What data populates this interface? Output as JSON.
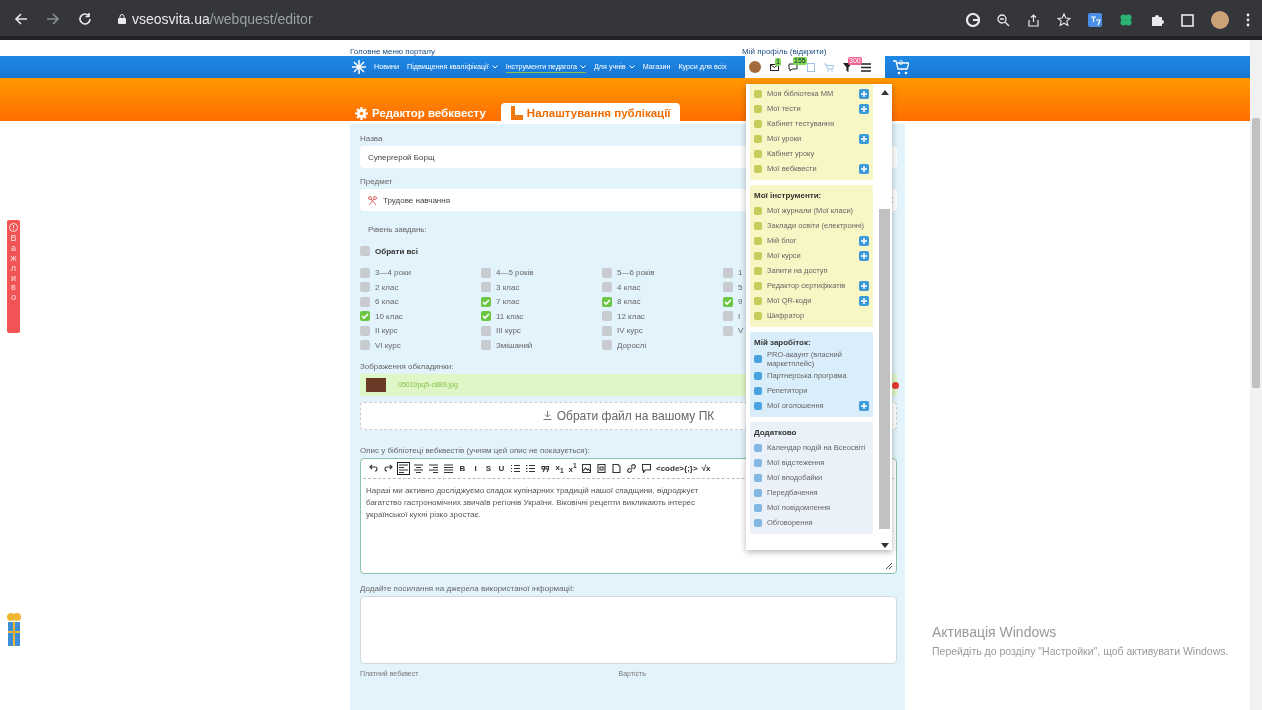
{
  "browser": {
    "url_domain": "vseosvita.ua",
    "url_path": "/webquest/editor"
  },
  "top_links": {
    "main_menu": "Головне меню порталу",
    "profile": "Мій профіль (відкрити)"
  },
  "nav": {
    "items": [
      {
        "label": "Новини",
        "dropdown": false,
        "selected": false
      },
      {
        "label": "Підвищення кваліфікації",
        "dropdown": true,
        "selected": false
      },
      {
        "label": "Інструменти педагога",
        "dropdown": true,
        "selected": true
      },
      {
        "label": "Для учнів",
        "dropdown": true,
        "selected": false
      },
      {
        "label": "Магазин",
        "dropdown": false,
        "selected": false
      },
      {
        "label": "Курси для всіх",
        "dropdown": false,
        "selected": false
      }
    ],
    "badges": {
      "mail": "1",
      "chat": "155",
      "filter": "300",
      "cart": "0"
    }
  },
  "tabs": [
    {
      "label": "Редактор вебквесту",
      "kind": "gear",
      "selected": false
    },
    {
      "label": "Налаштування публікації",
      "kind": "book",
      "selected": true
    }
  ],
  "important_tab": {
    "label": "Важливо"
  },
  "form": {
    "name_label": "Назва",
    "name_value": "Супергерой Борщ",
    "subject_label": "Предмет",
    "subject_value": "Трудове навчання",
    "level_label": "Рівень завдань:",
    "select_all": {
      "label": "Обрати всі",
      "checked": false
    },
    "levels": [
      {
        "label": "3—4 роки",
        "checked": false
      },
      {
        "label": "4—5 років",
        "checked": false
      },
      {
        "label": "5—6 років",
        "checked": false
      },
      {
        "label": "1",
        "checked": false
      },
      {
        "label": "2 клас",
        "checked": false
      },
      {
        "label": "3 клас",
        "checked": false
      },
      {
        "label": "4 клас",
        "checked": false
      },
      {
        "label": "5",
        "checked": false
      },
      {
        "label": "6 клас",
        "checked": false
      },
      {
        "label": "7 клас",
        "checked": true
      },
      {
        "label": "8 клас",
        "checked": true
      },
      {
        "label": "9",
        "checked": true
      },
      {
        "label": "10 клас",
        "checked": true
      },
      {
        "label": "11 клас",
        "checked": true
      },
      {
        "label": "12 клас",
        "checked": false
      },
      {
        "label": "I",
        "checked": false
      },
      {
        "label": "II курс",
        "checked": false
      },
      {
        "label": "III курс",
        "checked": false
      },
      {
        "label": "IV курс",
        "checked": false
      },
      {
        "label": "V",
        "checked": false
      },
      {
        "label": "VI курс",
        "checked": false
      },
      {
        "label": "Змішаний",
        "checked": false
      },
      {
        "label": "Дорослі",
        "checked": false
      }
    ],
    "cover_label": "Зображення обкладинки:",
    "cover_file": "05010pq5-c889.jpg",
    "upload_button": "Обрати файл на вашому ПК",
    "description_label": "Опис у бібліотеці вебквестів (учням цей опис не показується):",
    "toolbar": [
      {
        "kind": "icon",
        "selected": false
      },
      {
        "kind": "icon",
        "selected": false
      },
      {
        "kind": "icon",
        "selected": true
      },
      {
        "kind": "icon",
        "selected": false
      },
      {
        "kind": "icon",
        "selected": false
      },
      {
        "kind": "icon",
        "selected": false
      },
      {
        "kind": "text",
        "label": "B",
        "selected": false
      },
      {
        "kind": "text",
        "label": "I",
        "selected": false
      },
      {
        "kind": "text",
        "label": "S",
        "selected": false
      },
      {
        "kind": "text",
        "label": "U",
        "selected": false
      },
      {
        "kind": "icon",
        "selected": false
      },
      {
        "kind": "icon",
        "selected": false
      },
      {
        "kind": "icon",
        "selected": false
      },
      {
        "kind": "text",
        "label": "x$_{1}$",
        "selected": false
      },
      {
        "kind": "text",
        "label": "x$^{1}$",
        "selected": false
      },
      {
        "kind": "icon",
        "selected": false
      },
      {
        "kind": "icon",
        "selected": false
      },
      {
        "kind": "icon",
        "selected": false
      },
      {
        "kind": "icon",
        "selected": false
      },
      {
        "kind": "icon",
        "selected": false
      },
      {
        "kind": "text",
        "label": "<code>{;}>",
        "selected": false
      },
      {
        "kind": "text",
        "label": "√x",
        "selected": false
      }
    ],
    "description_lines": [
      "Наразі ми активно досліджуємо спадок кулінарних традицій нашої спадщини, відроджуєт",
      "багатство гастрономічних звичаїв регіонів України. Віковічні рецепти викликають інтерес",
      "української кухні різко зростає."
    ],
    "sources_label": "Додайте посилання на джерела використаної інформації:",
    "paid_label": "Платний вебквест",
    "price_label": "Вартість"
  },
  "profile_menu": [
    {
      "color": "#f8f6c4",
      "items": [
        {
          "label": "Моя бібліотека ММ",
          "add": true
        },
        {
          "label": "Мої тести",
          "add": true
        },
        {
          "label": "Кабінет тестування",
          "add": false
        },
        {
          "label": "Мої уроки",
          "add": true
        },
        {
          "label": "Кабінет уроку",
          "add": false
        },
        {
          "label": "Мої вебквести",
          "add": true
        }
      ]
    },
    {
      "title": "Мої інструменти:",
      "color": "#f8f6c4",
      "items": [
        {
          "label": "Мої журнали (Мої класи)",
          "add": false
        },
        {
          "label": "Заклади освіти (електронні)",
          "add": false
        },
        {
          "label": "Мій блог",
          "add": true
        },
        {
          "label": "Мої курси",
          "add": true
        },
        {
          "label": "Запити на доступ",
          "add": false
        },
        {
          "label": "Редактор сертифікатів",
          "add": true
        },
        {
          "label": "Мої QR-коди",
          "add": true
        },
        {
          "label": "Шифратор",
          "add": false
        }
      ]
    },
    {
      "title": "Мій заробіток:",
      "color": "#d9eefa",
      "items": [
        {
          "label": "PRO-акаунт (власний маркетплейс)",
          "add": false
        },
        {
          "label": "Партнерська програма",
          "add": false
        },
        {
          "label": "Репетитори",
          "add": false
        },
        {
          "label": "Мої оголошення",
          "add": true
        }
      ]
    },
    {
      "title": "Додатково",
      "color": "#ebf1f8",
      "items": [
        {
          "label": "Календар подій на Всеосвіті",
          "add": false
        },
        {
          "label": "Мої відстеження",
          "add": false
        },
        {
          "label": "Мої вподобайки",
          "add": false
        },
        {
          "label": "Передбачення",
          "add": false
        },
        {
          "label": "Мої повідомлення",
          "add": false
        },
        {
          "label": "Обговорення",
          "add": false
        }
      ]
    }
  ],
  "windows_activation": {
    "title": "Активація Windows",
    "text": "Перейдіть до розділу \"Настройки\", щоб активувати Windows."
  }
}
